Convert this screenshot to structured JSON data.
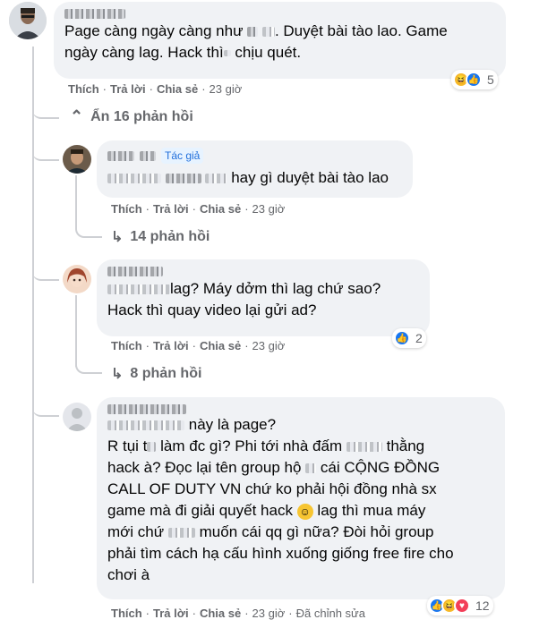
{
  "comment1": {
    "text_a": "Page càng ngày càng như",
    "text_b": ". Duyệt bài tào lao. Game",
    "text_c": "ngày càng lag. Hack thì",
    "text_d": " chịu quét.",
    "like": "Thích",
    "reply": "Trả lời",
    "share": "Chia sẻ",
    "time": "23 giờ",
    "reaction_count": "5",
    "hide_replies": "Ẩn 16 phản hồi"
  },
  "reply1": {
    "badge": "Tác giả",
    "text": "hay gì duyệt bài tào lao",
    "like": "Thích",
    "reply": "Trả lời",
    "share": "Chia sẻ",
    "time": "23 giờ",
    "more": "14 phản hồi"
  },
  "reply2": {
    "text_a": "lag? Máy dởm thì lag chứ sao?",
    "text_b": "Hack thì quay video lại gửi ad?",
    "like": "Thích",
    "reply": "Trả lời",
    "share": "Chia sẻ",
    "time": "23 giờ",
    "reaction_count": "2",
    "more": "8 phản hồi"
  },
  "reply3": {
    "line1": "này là page?",
    "line2a": "R tụi t",
    "line2b": "làm đc gì? Phi tới nhà đấm",
    "line2c": "thằng",
    "line3a": "hack à? Đọc lại tên group hộ",
    "line3b": "cái CỘNG ĐỒNG",
    "line4": "CALL OF DUTY VN chứ ko phải hội đồng nhà sx",
    "line5a": "game mà đi giải quyết hack",
    "line5b": "lag thì mua máy",
    "line6a": "mới chứ",
    "line6b": "muốn cái qq gì nữa? Đòi hỏi group",
    "line7": "phải tìm cách hạ cấu hình xuống giống free fire cho",
    "line8": "chơi à",
    "like": "Thích",
    "reply": "Trả lời",
    "share": "Chia sẻ",
    "time": "23 giờ",
    "edited": "Đã chỉnh sửa",
    "reaction_count": "12"
  },
  "icons": {
    "like": "like-icon",
    "haha": "haha-icon",
    "love": "love-icon",
    "reply_arrow": "reply-arrow-icon",
    "smile": "smile-emoji-icon"
  },
  "colors": {
    "bubble": "#f0f2f5",
    "meta": "#65676b",
    "like_blue": "#1877f2",
    "badge_text": "#216fdb",
    "badge_bg": "#e7f3ff"
  }
}
